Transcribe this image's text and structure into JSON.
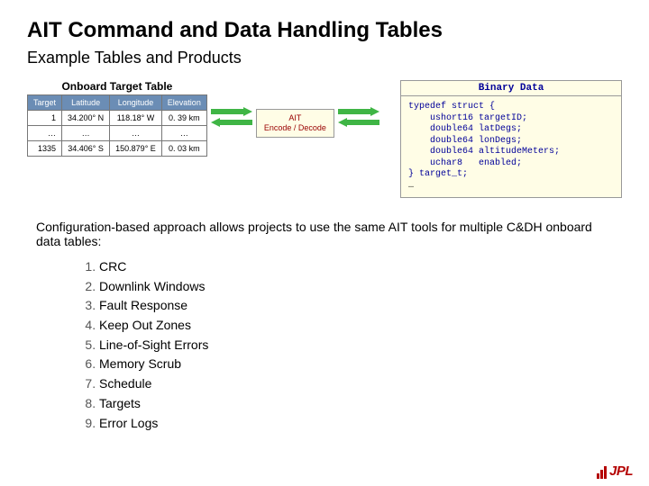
{
  "title": "AIT Command and Data Handling Tables",
  "subtitle": "Example Tables and Products",
  "table": {
    "caption": "Onboard Target Table",
    "headers": [
      "Target",
      "Latitude",
      "Longitude",
      "Elevation"
    ],
    "rows": [
      {
        "id": "1",
        "lat": "34.200° N",
        "lon": "118.18° W",
        "elev": "0. 39 km"
      },
      {
        "id": "…",
        "lat": "…",
        "lon": "…",
        "elev": "…"
      },
      {
        "id": "1335",
        "lat": "34.406° S",
        "lon": "150.879° E",
        "elev": "0. 03 km"
      }
    ]
  },
  "ait_box": {
    "line1": "AIT",
    "line2": "Encode / Decode"
  },
  "code": {
    "caption": "Binary Data",
    "body": "typedef struct {\n    ushort16 targetID;\n    double64 latDegs;\n    double64 lonDegs;\n    double64 altitudeMeters;\n    uchar8   enabled;\n} target_t;",
    "ellipsis": "…"
  },
  "body_text": "Configuration-based approach allows projects to use the same AIT tools for multiple C&DH onboard data tables:",
  "list": [
    "CRC",
    "Downlink Windows",
    "Fault Response",
    "Keep Out Zones",
    "Line-of-Sight Errors",
    "Memory Scrub",
    "Schedule",
    "Targets",
    "Error Logs"
  ],
  "logo": "JPL"
}
